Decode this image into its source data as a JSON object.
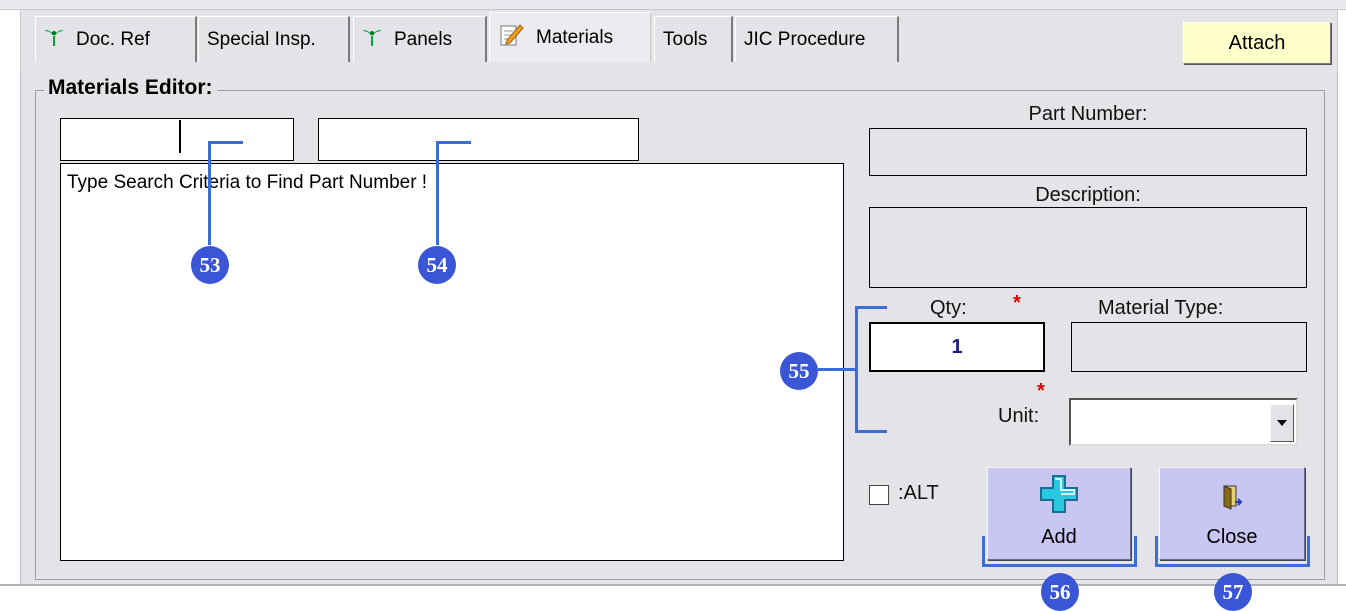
{
  "tabs": [
    {
      "label": "Doc. Ref",
      "icon": "plant-icon",
      "active": false
    },
    {
      "label": "Special Insp.",
      "icon": null,
      "active": false
    },
    {
      "label": "Panels",
      "icon": "plant-icon",
      "active": false
    },
    {
      "label": "Materials",
      "icon": "notepad-pencil-icon",
      "active": true
    },
    {
      "label": "Tools",
      "icon": null,
      "active": false
    },
    {
      "label": "JIC Procedure",
      "icon": null,
      "active": false
    }
  ],
  "attach_label": "Attach",
  "editor": {
    "title": "Materials Editor:",
    "search1_value": "",
    "search2_value": "",
    "results_text": "Type Search Criteria to Find Part Number !",
    "part_number_label": "Part Number:",
    "part_number_value": "",
    "description_label": "Description:",
    "description_value": "",
    "qty_label": "Qty:",
    "qty_value": "1",
    "required_mark": "*",
    "material_type_label": "Material Type:",
    "material_type_value": "",
    "unit_label": "Unit:",
    "unit_value": "",
    "alt_label": ":ALT",
    "alt_checked": false,
    "add_label": "Add",
    "close_label": "Close"
  },
  "callouts": [
    "53",
    "54",
    "55",
    "56",
    "57"
  ],
  "colors": {
    "callout": "#3a55d6",
    "attach_bg": "#ffffcc",
    "button_bg": "#c9c7f2",
    "panel_bg": "#e4e4e8",
    "required": "#e00000"
  }
}
